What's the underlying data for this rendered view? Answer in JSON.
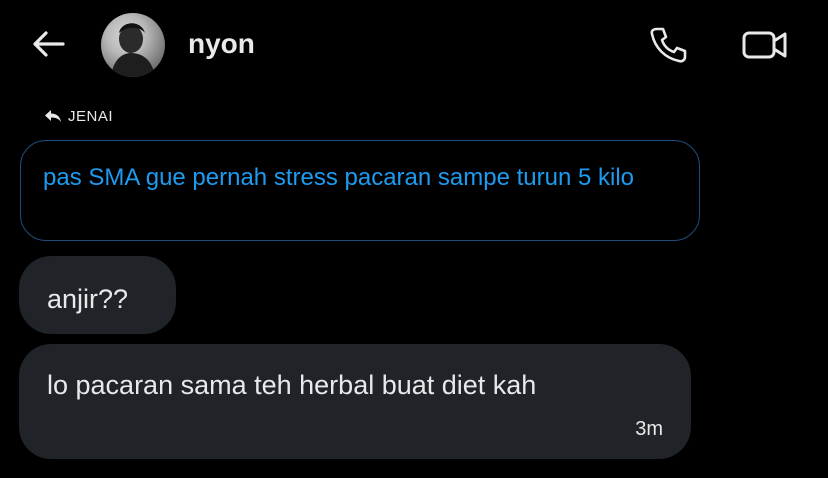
{
  "header": {
    "contact_name": "nyon",
    "icons": {
      "back": "arrow-left-icon",
      "call": "phone-icon",
      "video": "video-camera-icon"
    }
  },
  "thread": {
    "reply_label": "JENAI",
    "quoted_message": "pas SMA gue pernah stress pacaran sampe turun 5 kilo",
    "messages": [
      {
        "text": "anjir??"
      },
      {
        "text": "lo pacaran sama teh herbal buat diet kah",
        "time": "3m"
      }
    ]
  },
  "colors": {
    "background": "#000000",
    "bubble": "#202327",
    "quote_text": "#1d9bf0",
    "quote_border": "#1d4e79"
  }
}
